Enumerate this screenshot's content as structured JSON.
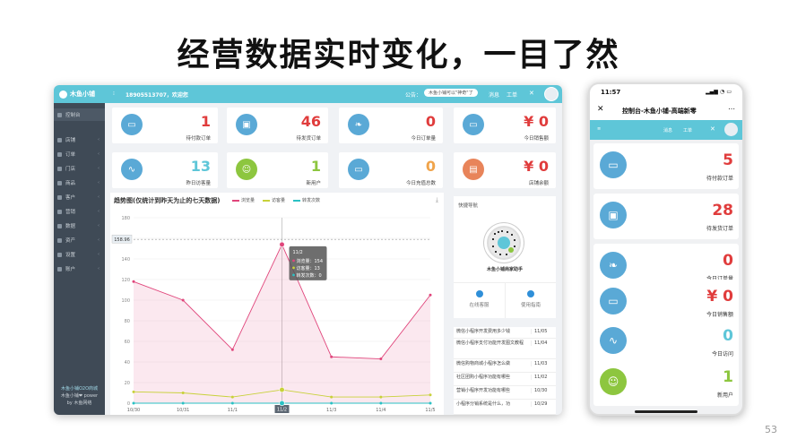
{
  "slide": {
    "title": "经营数据实时变化，一目了然",
    "page_number": "53"
  },
  "colors": {
    "teal": "#5ec6d8",
    "blue": "#5aa9d6",
    "green": "#8dc63f",
    "red": "#e03c3c",
    "orange": "#f0a44b",
    "pink": "#e0457b",
    "yellow": "#c8d13a",
    "cyan": "#2bc1c4"
  },
  "desktop": {
    "topbar": {
      "logo": "木鱼小铺",
      "phone_text": "18905513707，欢迎您",
      "notice_label": "公告：",
      "notice": "木鱼小铺可以\"神奇\"了",
      "link_1": "消息",
      "link_2": "工单"
    },
    "sidebar": {
      "items": [
        {
          "label": "控制台",
          "icon": "dashboard-icon"
        },
        {
          "label": "店铺",
          "icon": "store-icon"
        },
        {
          "label": "订单",
          "icon": "order-icon"
        },
        {
          "label": "门店",
          "icon": "shop-icon"
        },
        {
          "label": "商品",
          "icon": "goods-icon"
        },
        {
          "label": "客户",
          "icon": "customer-icon"
        },
        {
          "label": "营销",
          "icon": "marketing-icon"
        },
        {
          "label": "数据",
          "icon": "data-icon"
        },
        {
          "label": "资产",
          "icon": "asset-icon"
        },
        {
          "label": "设置",
          "icon": "settings-icon"
        },
        {
          "label": "账户",
          "icon": "account-icon"
        }
      ],
      "footer_1": "木鱼小铺O2O商城",
      "footer_2": "木鱼小铺❤ power",
      "footer_3": "by 木鱼网络"
    },
    "stats": [
      {
        "value": "1",
        "label": "待付款订单",
        "color": "#e03c3c",
        "icon": "money-icon",
        "circle": "#5aa9d6"
      },
      {
        "value": "46",
        "label": "待发货订单",
        "color": "#e03c3c",
        "icon": "truck-icon",
        "circle": "#5aa9d6"
      },
      {
        "value": "0",
        "label": "今日订单量",
        "color": "#e03c3c",
        "icon": "leaf-icon",
        "circle": "#5aa9d6"
      },
      {
        "value": "¥ 0",
        "label": "今日销售额",
        "color": "#e03c3c",
        "icon": "money-icon",
        "circle": "#5aa9d6"
      },
      {
        "value": "13",
        "label": "昨日访客量",
        "color": "#5ec6d8",
        "icon": "pulse-icon",
        "circle": "#5aa9d6"
      },
      {
        "value": "1",
        "label": "新用户",
        "color": "#8dc63f",
        "icon": "user-icon",
        "circle": "#8dc63f"
      },
      {
        "value": "0",
        "label": "今日充值总数",
        "color": "#f0a44b",
        "icon": "money-icon",
        "circle": "#5aa9d6"
      },
      {
        "value": "¥ 0",
        "label": "店铺余额",
        "color": "#e03c3c",
        "icon": "wallet-icon",
        "circle": "#e8845a"
      }
    ],
    "quicknav": {
      "title": "快捷导航",
      "qr_caption": "木鱼小铺商家助手",
      "btn_1": "在线客服",
      "btn_2": "使用指南"
    },
    "news": [
      {
        "title": "微信小程序开发费用多少钱",
        "date": "11/05"
      },
      {
        "title": "微信小程序支付功能开发图文教程",
        "date": "11/04"
      },
      {
        "title": "微信购物商城小程序怎么做",
        "date": "11/03"
      },
      {
        "title": "社区团购小程序功能有哪些",
        "date": "11/02"
      },
      {
        "title": "营销小程序开发功能有哪些",
        "date": "10/30"
      },
      {
        "title": "小程序分销系统是什么，功",
        "date": "10/29"
      }
    ]
  },
  "chart_data": {
    "type": "line",
    "title": "趋势图(仅统计到昨天为止的七天数据)",
    "x": [
      "10/30",
      "10/31",
      "11/1",
      "11/2",
      "11/3",
      "11/4",
      "11/5"
    ],
    "series": [
      {
        "name": "浏览量",
        "values": [
          118,
          100,
          52,
          154,
          45,
          43,
          105
        ],
        "color": "#e0457b"
      },
      {
        "name": "访客量",
        "values": [
          11,
          10,
          6,
          13,
          6,
          6,
          8
        ],
        "color": "#c8d13a"
      },
      {
        "name": "转发次数",
        "values": [
          0,
          0,
          0,
          0,
          0,
          0,
          0
        ],
        "color": "#2bc1c4"
      }
    ],
    "ylim": [
      0,
      180
    ],
    "yticks": [
      "0",
      "20",
      "40",
      "60",
      "80",
      "100",
      "120",
      "140",
      "160",
      "180"
    ],
    "ref_label": "158.96",
    "ref_value": 158.96,
    "tooltip": {
      "title": "11/2",
      "line_1": "浏览量：154",
      "line_2": "访客量：13",
      "line_3": "转发次数：0"
    },
    "x_highlight": "11/2",
    "download_icon": "download-icon",
    "grid": true,
    "legend": "top"
  },
  "phone": {
    "time": "11:57",
    "signal": "▂▄▆ ◔ ▭",
    "title": "控制台-木鱼小铺-高端新零",
    "bar_link_1": "消息",
    "bar_link_2": "工单",
    "cards": [
      {
        "value": "5",
        "label": "待付款订单",
        "color": "#e03c3c",
        "circle": "#5aa9d6",
        "icon": "money-icon"
      },
      {
        "value": "28",
        "label": "待发货订单",
        "color": "#e03c3c",
        "circle": "#5aa9d6",
        "icon": "truck-icon"
      },
      {
        "value": "0",
        "label": "今日订单量",
        "color": "#e03c3c",
        "circle": "#5aa9d6",
        "icon": "leaf-icon"
      },
      {
        "value": "¥ 0",
        "label": "今日销售额",
        "color": "#e03c3c",
        "circle": "#5aa9d6",
        "icon": "money-icon"
      },
      {
        "value": "0",
        "label": "今日访问",
        "color": "#5ec6d8",
        "circle": "#5aa9d6",
        "icon": "pulse-icon"
      },
      {
        "value": "1",
        "label": "新用户",
        "color": "#8dc63f",
        "circle": "#8dc63f",
        "icon": "user-icon"
      }
    ]
  }
}
